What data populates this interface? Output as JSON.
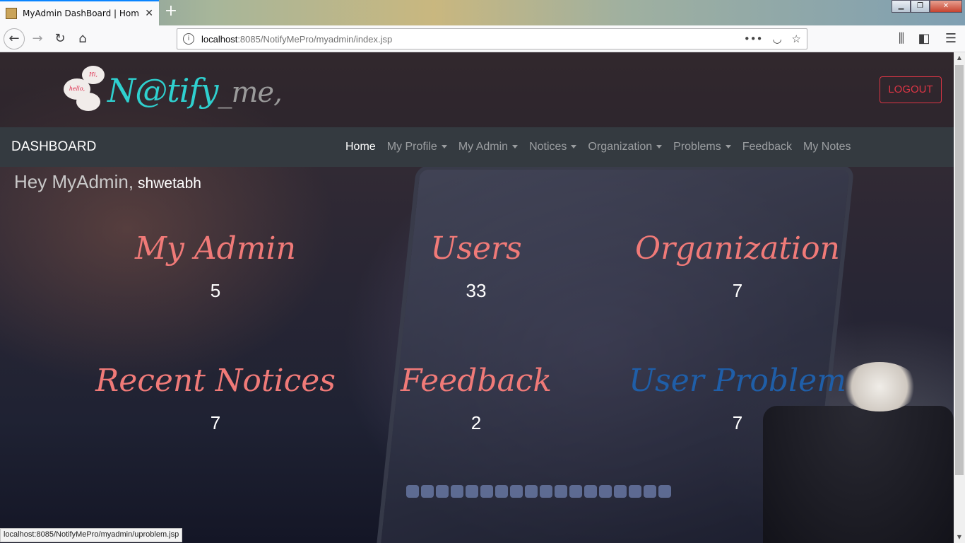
{
  "browser": {
    "tab_title": "MyAdmin DashBoard | Home",
    "tab_close": "✕",
    "new_tab": "+",
    "url_host": "localhost",
    "url_rest": ":8085/NotifyMePro/myadmin/index.jsp",
    "status_url": "localhost:8085/NotifyMePro/myadmin/uproblem.jsp"
  },
  "header": {
    "logo_main": "N@tify",
    "logo_sep": "_",
    "logo_suffix": "me,",
    "bubble_1": "hello,",
    "bubble_2": "Hi,",
    "logout_label": "LOGOUT"
  },
  "nav": {
    "brand": "DASHBOARD",
    "items": [
      {
        "label": "Home"
      },
      {
        "label": "My Profile"
      },
      {
        "label": "My Admin"
      },
      {
        "label": "Notices"
      },
      {
        "label": "Organization"
      },
      {
        "label": "Problems"
      },
      {
        "label": "Feedback"
      },
      {
        "label": "My Notes"
      }
    ]
  },
  "greeting": {
    "text": "Hey MyAdmin,",
    "username": "shwetabh"
  },
  "stats": [
    {
      "label": "My Admin",
      "value": "5"
    },
    {
      "label": "Users",
      "value": "33"
    },
    {
      "label": "Organization",
      "value": "7"
    },
    {
      "label": "Recent Notices",
      "value": "7"
    },
    {
      "label": "Feedback",
      "value": "2"
    },
    {
      "label": "User Problem",
      "value": "7"
    }
  ],
  "colors": {
    "accent_red": "#dc3545",
    "stat_label": "#f07a78",
    "stat_label_hover": "#1f5ea8",
    "logo_teal": "#2fd0cf",
    "navbar": "#343a40"
  }
}
